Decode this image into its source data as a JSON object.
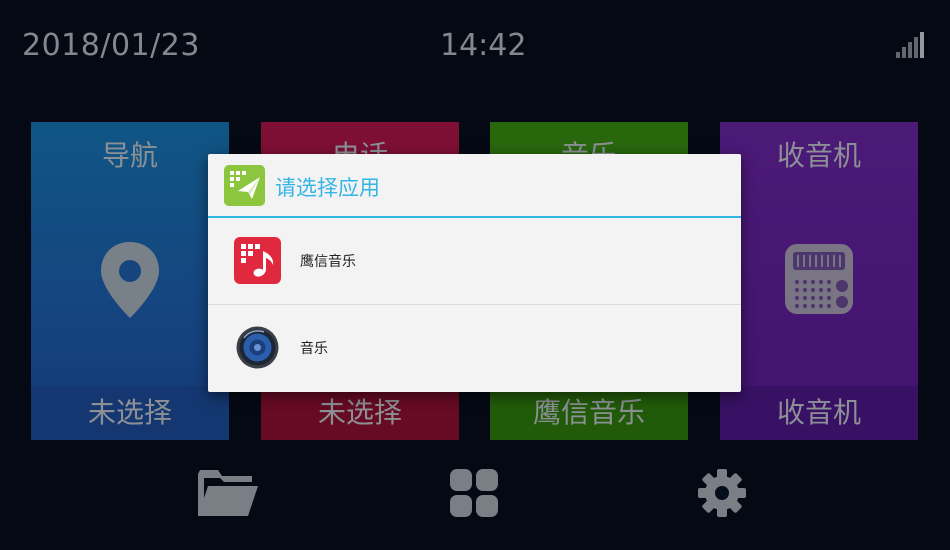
{
  "status": {
    "date": "2018/01/23",
    "time": "14:42"
  },
  "tiles": [
    {
      "title": "导航",
      "footer": "未选择",
      "icon": "location-pin-icon",
      "color": "#1e5fb0"
    },
    {
      "title": "电话",
      "footer": "未选择",
      "icon": "phone-icon",
      "color": "#9a1038"
    },
    {
      "title": "音乐",
      "footer": "鹰信音乐",
      "icon": "music-icon",
      "color": "#2f8a0f"
    },
    {
      "title": "收音机",
      "footer": "收音机",
      "icon": "radio-icon",
      "color": "#5a1b98"
    }
  ],
  "dialog": {
    "title": "请选择应用",
    "options": [
      {
        "label": "鹰信音乐",
        "icon": "yingxin-music-app-icon"
      },
      {
        "label": "音乐",
        "icon": "speaker-music-app-icon"
      }
    ]
  },
  "dock": [
    {
      "icon": "folder-icon"
    },
    {
      "icon": "apps-grid-icon"
    },
    {
      "icon": "settings-gear-icon"
    }
  ],
  "colors": {
    "accent": "#33b5e5",
    "background": "#060d1c"
  }
}
